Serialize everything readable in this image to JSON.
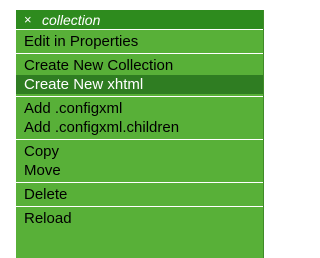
{
  "menu": {
    "title": "collection",
    "close_glyph": "×",
    "groups": [
      {
        "items": [
          "Edit in Properties"
        ]
      },
      {
        "items": [
          "Create New Collection",
          "Create New xhtml"
        ]
      },
      {
        "items": [
          "Add .configxml",
          "Add .configxml.children"
        ]
      },
      {
        "items": [
          "Copy",
          "Move"
        ]
      },
      {
        "items": [
          "Delete"
        ]
      },
      {
        "items": [
          "Reload"
        ]
      }
    ],
    "selected_item": "Create New xhtml",
    "colors": {
      "background": "#58b038",
      "title_bar": "#2e8b1e",
      "selected": "#2f7d22",
      "separator": "#ffffff"
    }
  }
}
